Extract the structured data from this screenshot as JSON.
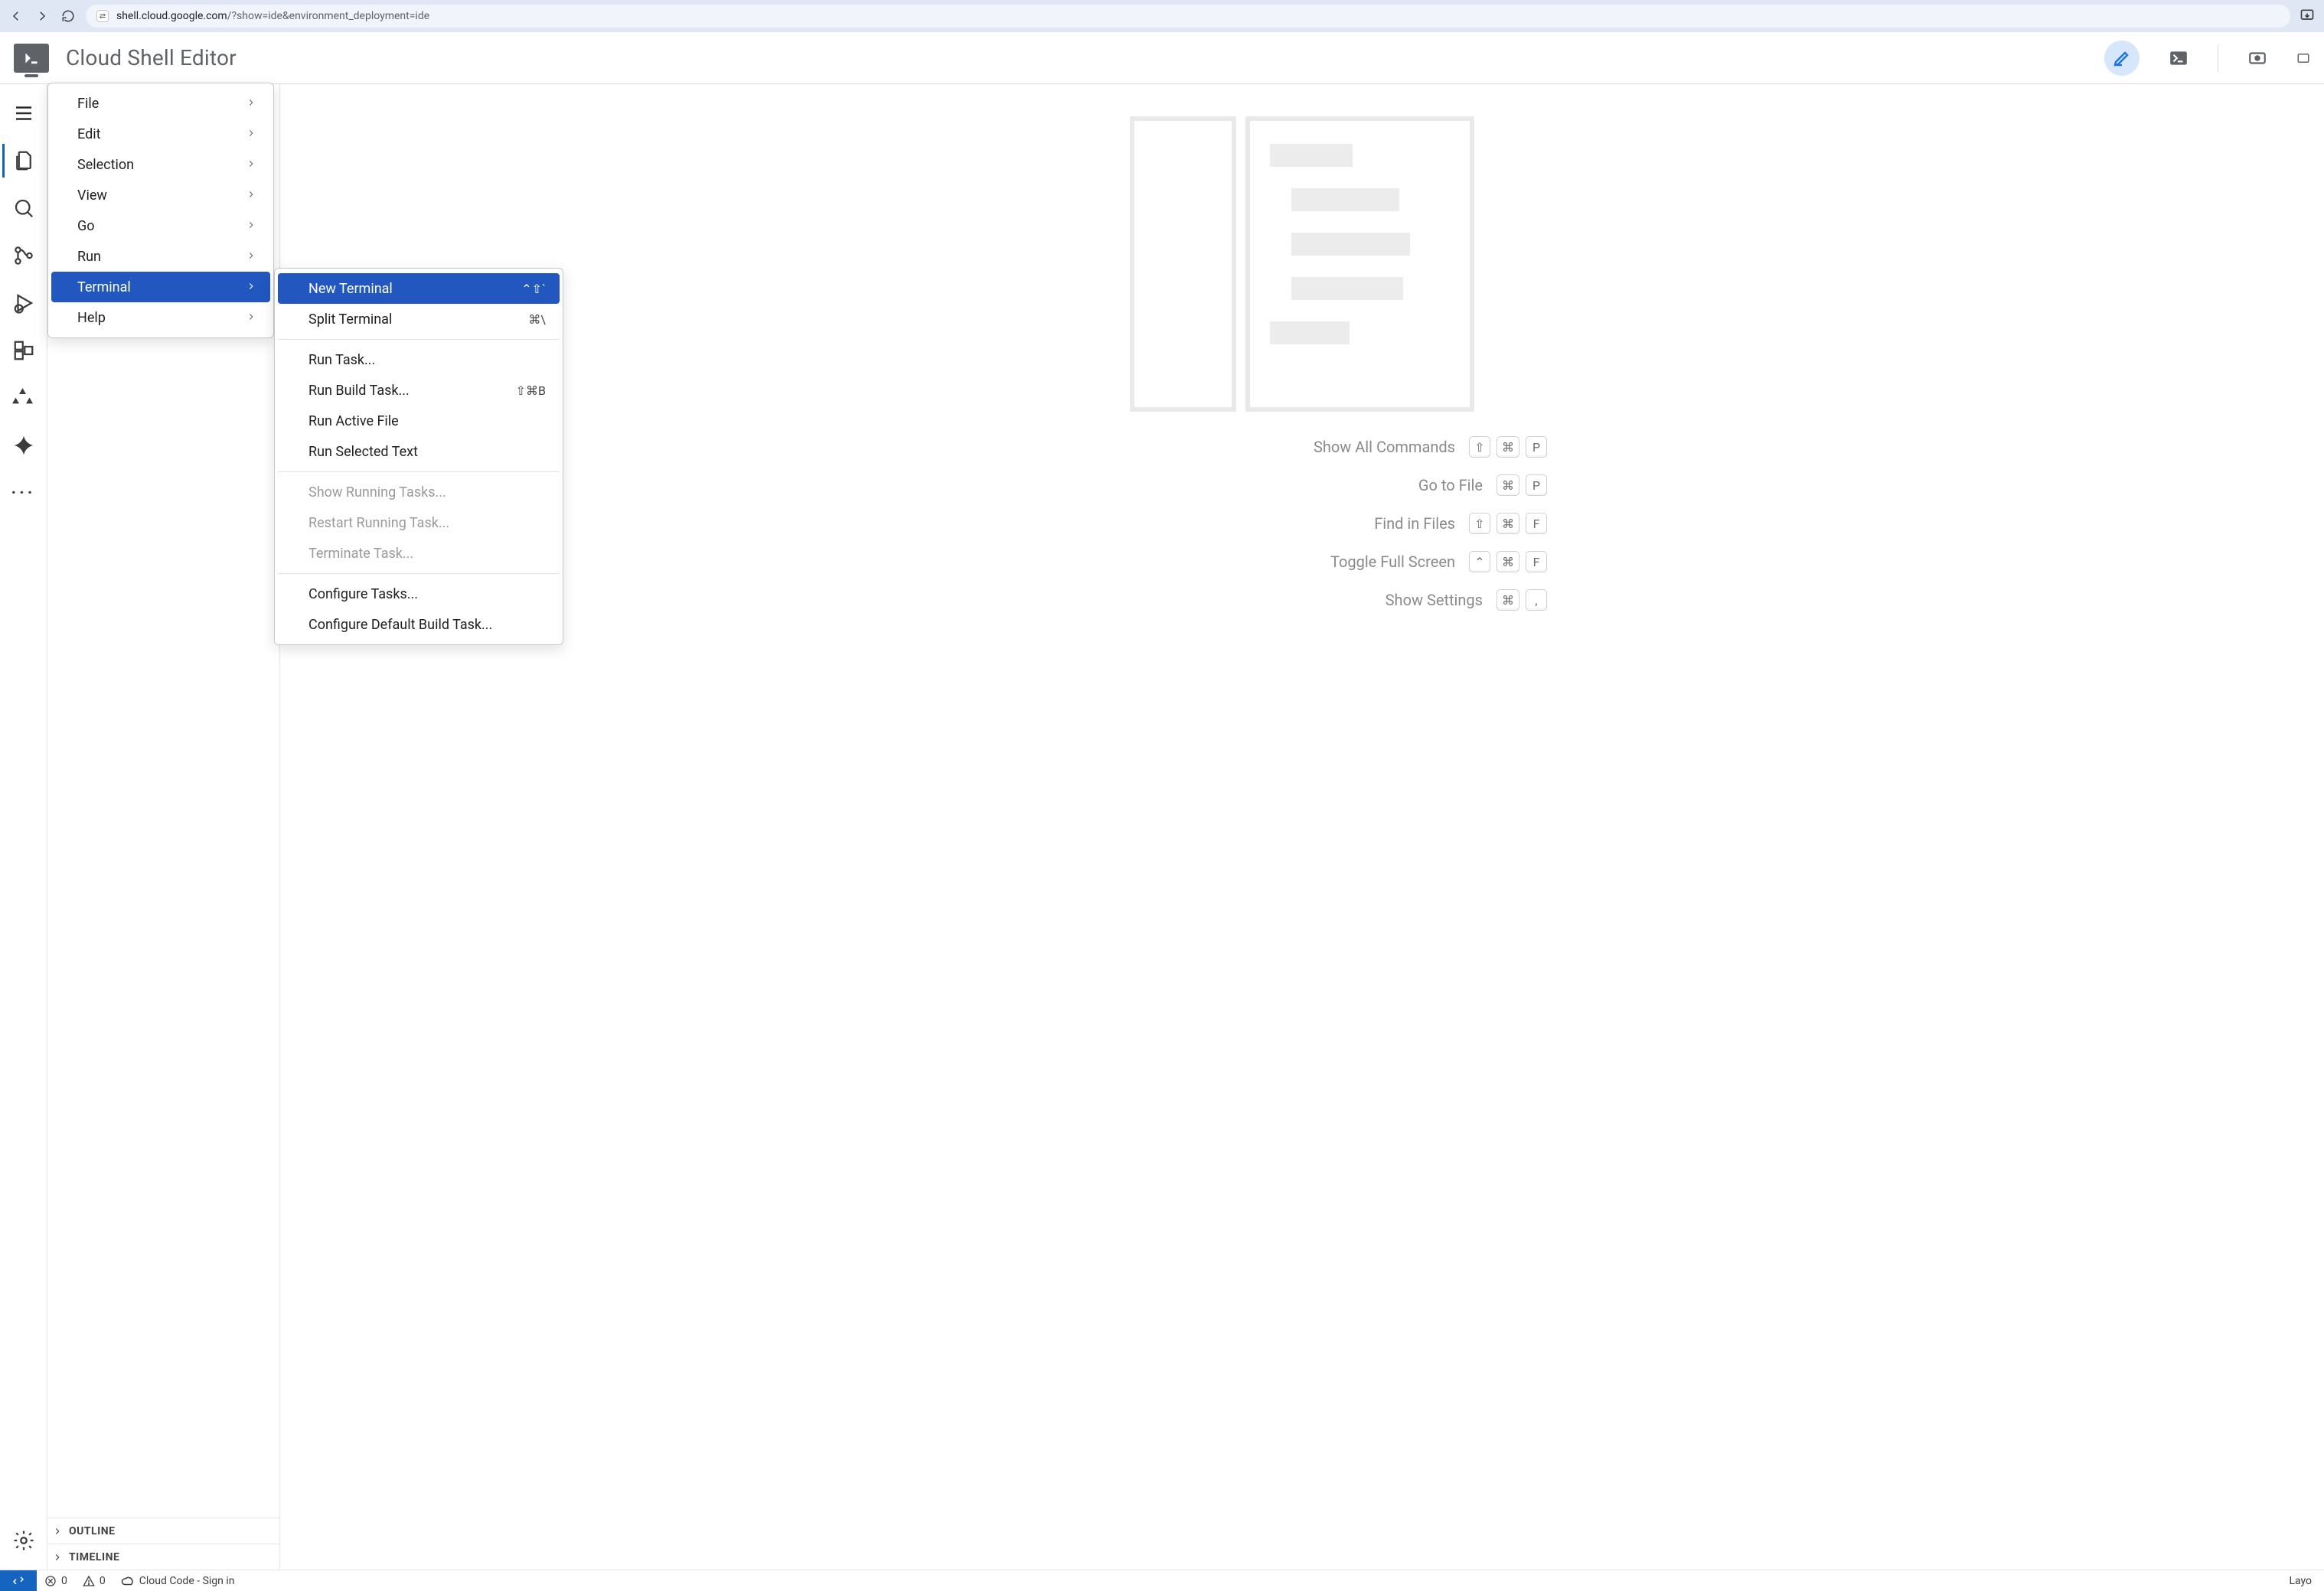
{
  "browser": {
    "host": "shell.cloud.google.com",
    "path": "/?show=ide&environment_deployment=ide",
    "site_glyph": "⇄"
  },
  "header": {
    "title": "Cloud Shell Editor"
  },
  "menu": {
    "items": [
      {
        "label": "File"
      },
      {
        "label": "Edit"
      },
      {
        "label": "Selection"
      },
      {
        "label": "View"
      },
      {
        "label": "Go"
      },
      {
        "label": "Run"
      },
      {
        "label": "Terminal",
        "active": true
      },
      {
        "label": "Help"
      }
    ]
  },
  "submenu": {
    "groups": [
      [
        {
          "label": "New Terminal",
          "shortcut": "⌃⇧`",
          "active": true
        },
        {
          "label": "Split Terminal",
          "shortcut": "⌘\\"
        }
      ],
      [
        {
          "label": "Run Task..."
        },
        {
          "label": "Run Build Task...",
          "shortcut": "⇧⌘B"
        },
        {
          "label": "Run Active File"
        },
        {
          "label": "Run Selected Text"
        }
      ],
      [
        {
          "label": "Show Running Tasks...",
          "disabled": true
        },
        {
          "label": "Restart Running Task...",
          "disabled": true
        },
        {
          "label": "Terminate Task...",
          "disabled": true
        }
      ],
      [
        {
          "label": "Configure Tasks..."
        },
        {
          "label": "Configure Default Build Task..."
        }
      ]
    ]
  },
  "side_sections": {
    "outline": "OUTLINE",
    "timeline": "TIMELINE"
  },
  "hints": [
    {
      "label": "Show All Commands",
      "keys": [
        "⇧",
        "⌘",
        "P"
      ]
    },
    {
      "label": "Go to File",
      "keys": [
        "⌘",
        "P"
      ]
    },
    {
      "label": "Find in Files",
      "keys": [
        "⇧",
        "⌘",
        "F"
      ]
    },
    {
      "label": "Toggle Full Screen",
      "keys": [
        "⌃",
        "⌘",
        "F"
      ]
    },
    {
      "label": "Show Settings",
      "keys": [
        "⌘",
        ","
      ]
    }
  ],
  "status": {
    "errors": "0",
    "warnings": "0",
    "cloud": "Cloud Code - Sign in",
    "right": "Layo"
  }
}
